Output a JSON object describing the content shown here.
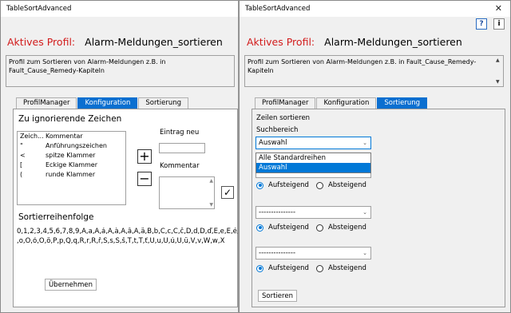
{
  "left": {
    "title": "TableSortAdvanced",
    "profile_label": "Aktives Profil:",
    "profile_name": "Alarm-Meldungen_sortieren",
    "description": "Profil zum Sortieren von Alarm-Meldungen z.B. in Fault_Cause_Remedy-Kapiteln",
    "tabs": [
      {
        "label": "ProfilManager",
        "active": false
      },
      {
        "label": "Konfiguration",
        "active": true
      },
      {
        "label": "Sortierung",
        "active": false
      }
    ],
    "ignore_heading": "Zu ignorierende Zeichen",
    "list_headers": [
      "Zeich...",
      "Kommentar"
    ],
    "list_rows": [
      [
        "\"",
        "Anführungszeichen"
      ],
      [
        "<",
        "spitze Klammer"
      ],
      [
        "[",
        "Eckige Klammer"
      ],
      [
        "(",
        "runde Klammer"
      ]
    ],
    "add_symbol": "+",
    "remove_symbol": "−",
    "entry_new_label": "Eintrag neu",
    "comment_label": "Kommentar",
    "confirm_symbol": "✓",
    "order_heading": "Sortierreihenfolge",
    "order_line1": "0,1,2,3,4,5,6,7,8,9,A,a,Á,á,À,à,Â,â,Ä,ä,B,b,C,c,Č,č,D,d,Ď,ď,E,e,É,é,F,f,G,g,H,h",
    "order_line2": ",o,Ó,ó,Ö,ö,P,p,Q,q,R,r,Ř,ř,S,s,Š,š,T,t,Ť,ť,U,u,Ú,ú,Ü,ü,V,v,W,w,X",
    "apply_button": "Übernehmen"
  },
  "right": {
    "title": "TableSortAdvanced",
    "close_symbol": "✕",
    "help_symbol": "?",
    "info_symbol": "i",
    "profile_label": "Aktives Profil:",
    "profile_name": "Alarm-Meldungen_sortieren",
    "description": "Profil zum Sortieren von Alarm-Meldungen z.B. in Fault_Cause_Remedy-Kapiteln",
    "tabs": [
      {
        "label": "ProfilManager",
        "active": false
      },
      {
        "label": "Konfiguration",
        "active": false
      },
      {
        "label": "Sortierung",
        "active": true
      }
    ],
    "rows_heading": "Zeilen sortieren",
    "search_label": "Suchbereich",
    "search_value": "Auswahl",
    "dropdown_options": [
      "Alle Standardreihen",
      "Auswahl"
    ],
    "dropdown_selected": "Auswahl",
    "criteria": [
      {
        "value": "---------------",
        "asc": "Aufsteigend",
        "desc": "Absteigend",
        "selected": "asc"
      },
      {
        "value": "---------------",
        "asc": "Aufsteigend",
        "desc": "Absteigend",
        "selected": "asc"
      },
      {
        "value": "---------------",
        "asc": "Aufsteigend",
        "desc": "Absteigend",
        "selected": "asc"
      }
    ],
    "sort_button": "Sortieren"
  },
  "colors": {
    "accent": "#0b6fd0",
    "profile_label": "#d21c1c",
    "selection": "#0078d7"
  }
}
